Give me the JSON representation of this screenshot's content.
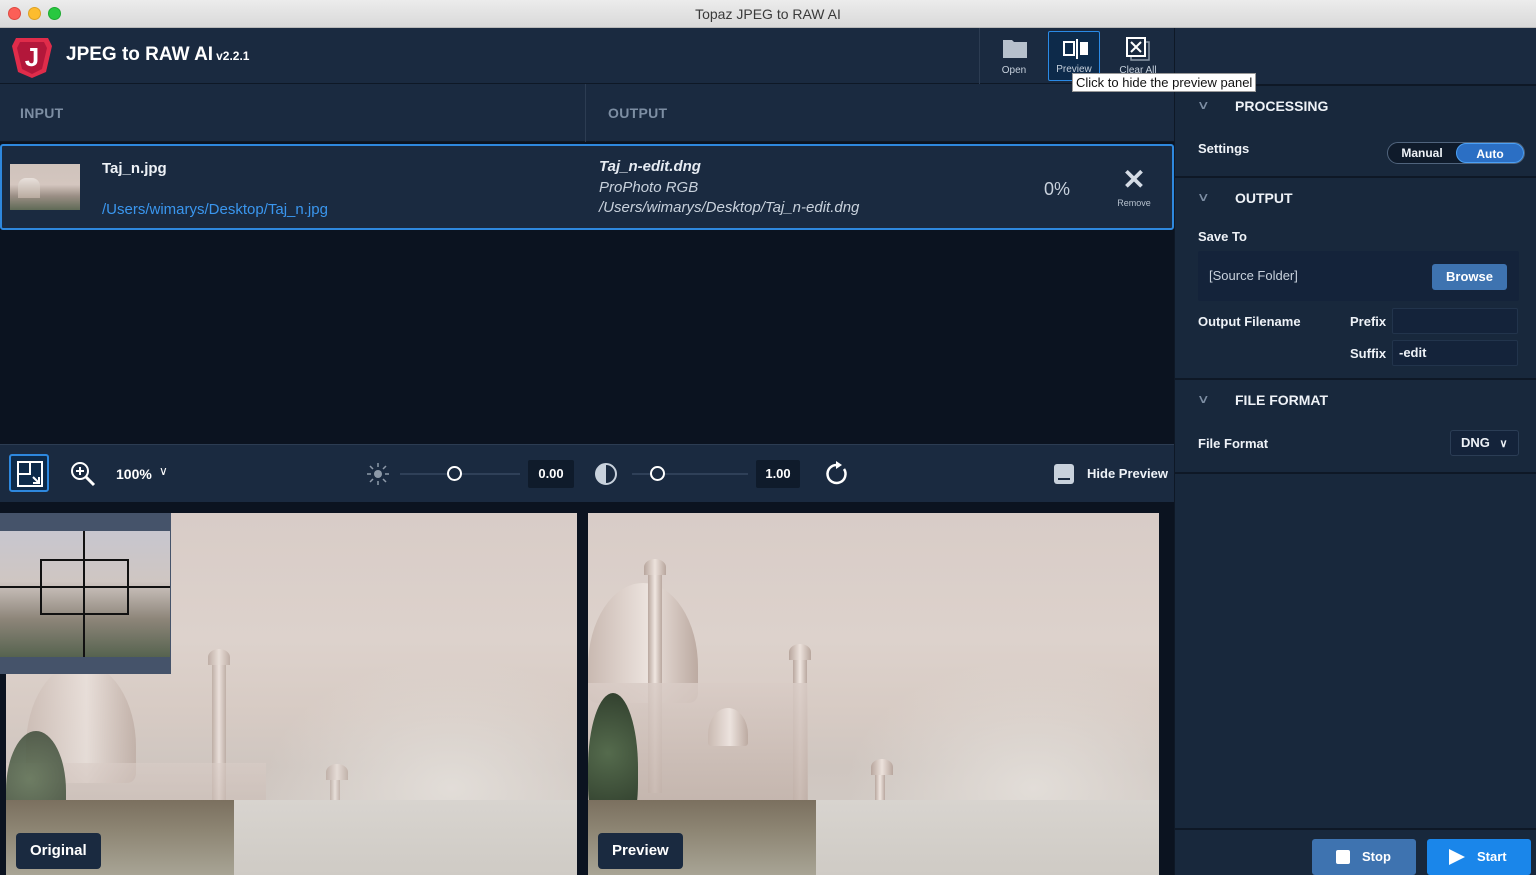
{
  "window": {
    "title": "Topaz JPEG to RAW AI"
  },
  "header": {
    "app_name": "JPEG to RAW AI",
    "version": "v2.2.1",
    "toolbar": {
      "open_label": "Open",
      "preview_label": "Preview",
      "clear_label": "Clear All",
      "preview_tooltip": "Click to hide the preview panel"
    }
  },
  "columns": {
    "input": "INPUT",
    "output": "OUTPUT"
  },
  "file": {
    "input_name": "Taj_n.jpg",
    "input_path": "/Users/wimarys/Desktop/Taj_n.jpg",
    "output_name": "Taj_n-edit.dng",
    "output_colorspace": "ProPhoto RGB",
    "output_path": "/Users/wimarys/Desktop/Taj_n-edit.dng",
    "progress": "0%",
    "remove_label": "Remove"
  },
  "preview_toolbar": {
    "zoom": "100%",
    "exposure_value": "0.00",
    "contrast_value": "1.00",
    "hide_preview_label": "Hide Preview"
  },
  "panes": {
    "left_label": "Original",
    "right_label": "Preview"
  },
  "right_panel": {
    "processing": {
      "title": "PROCESSING",
      "settings_label": "Settings",
      "manual": "Manual",
      "auto": "Auto",
      "selected": "Auto"
    },
    "output": {
      "title": "OUTPUT",
      "save_to_label": "Save To",
      "save_to_value": "[Source Folder]",
      "browse_label": "Browse",
      "filename_label": "Output Filename",
      "prefix_label": "Prefix",
      "prefix_value": "",
      "suffix_label": "Suffix",
      "suffix_value": "-edit"
    },
    "file_format": {
      "title": "FILE FORMAT",
      "label": "File Format",
      "value": "DNG"
    },
    "actions": {
      "stop": "Stop",
      "start": "Start"
    }
  },
  "colors": {
    "accent": "#2e88de",
    "panel": "#1a2a40",
    "background": "#0b1320",
    "browse": "#3e73b0",
    "start": "#1a86ea"
  }
}
